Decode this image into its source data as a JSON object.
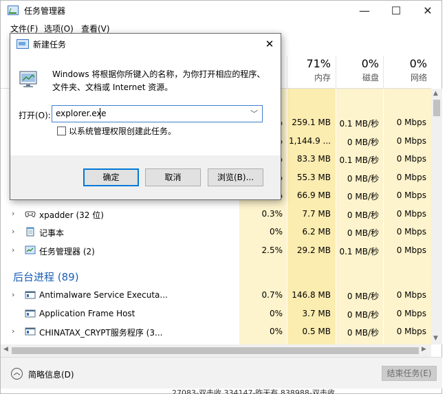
{
  "window": {
    "title": "任务管理器",
    "controls": {
      "minimize": "—",
      "maximize": "☐",
      "close": "✕"
    }
  },
  "menu": [
    "文件(F)",
    "选项(O)",
    "查看(V)"
  ],
  "columns": [
    {
      "pct": "71%",
      "name": "内存"
    },
    {
      "pct": "0%",
      "name": "磁盘"
    },
    {
      "pct": "0%",
      "name": "网络"
    }
  ],
  "rows": [
    {
      "name": "",
      "cpu": "%",
      "mem": "259.1 MB",
      "disk": "0.1 MB/秒",
      "net": "0 Mbps",
      "expand": false,
      "icon": ""
    },
    {
      "name": "",
      "cpu": "%",
      "mem": "1,144.9 ...",
      "disk": "0 MB/秒",
      "net": "0 Mbps",
      "expand": false,
      "icon": ""
    },
    {
      "name": "",
      "cpu": "%",
      "mem": "83.3 MB",
      "disk": "0.1 MB/秒",
      "net": "0 Mbps",
      "expand": false,
      "icon": ""
    },
    {
      "name": "",
      "cpu": "%",
      "mem": "55.3 MB",
      "disk": "0 MB/秒",
      "net": "0 Mbps",
      "expand": false,
      "icon": ""
    },
    {
      "name": "",
      "cpu": "%",
      "mem": "66.9 MB",
      "disk": "0 MB/秒",
      "net": "0 Mbps",
      "expand": false,
      "icon": ""
    },
    {
      "name": "xpadder (32 位)",
      "cpu": "0.3%",
      "mem": "7.7 MB",
      "disk": "0 MB/秒",
      "net": "0 Mbps",
      "expand": true,
      "icon": "gamepad-icon"
    },
    {
      "name": "记事本",
      "cpu": "0%",
      "mem": "6.2 MB",
      "disk": "0 MB/秒",
      "net": "0 Mbps",
      "expand": true,
      "icon": "notepad-icon"
    },
    {
      "name": "任务管理器 (2)",
      "cpu": "2.5%",
      "mem": "29.2 MB",
      "disk": "0.1 MB/秒",
      "net": "0 Mbps",
      "expand": true,
      "icon": "task-manager-icon"
    }
  ],
  "background_group": {
    "title": "后台进程 (89)"
  },
  "bg_rows": [
    {
      "name": "Antimalware Service Executa...",
      "cpu": "0.7%",
      "mem": "146.8 MB",
      "disk": "0 MB/秒",
      "net": "0 Mbps",
      "expand": true,
      "icon": "service-icon"
    },
    {
      "name": "Application Frame Host",
      "cpu": "0%",
      "mem": "3.7 MB",
      "disk": "0 MB/秒",
      "net": "0 Mbps",
      "expand": false,
      "icon": "app-icon"
    },
    {
      "name": "CHINATAX_CRYPT服务程序 (3...",
      "cpu": "0%",
      "mem": "0.5 MB",
      "disk": "0 MB/秒",
      "net": "0 Mbps",
      "expand": true,
      "icon": "service-icon"
    }
  ],
  "footer": {
    "fewer_details": "简略信息(D)",
    "end_task": "结束任务(E)",
    "bottom_strip": "27083-双击收      334147-昨天有      838988-双击收"
  },
  "run_dialog": {
    "title": "新建任务",
    "close": "✕",
    "description": "Windows 将根据你所键入的名称，为你打开相应的程序、文件夹、文档或 Internet 资源。",
    "open_label": "打开(O):",
    "open_value": "explorer.exe",
    "admin_checkbox": "以系统管理权限创建此任务。",
    "admin_checked": false,
    "buttons": {
      "ok": "确定",
      "cancel": "取消",
      "browse": "浏览(B)..."
    }
  },
  "colors": {
    "accent": "#1a5fb4",
    "cpu_band": "#fdf3cc",
    "mem_band": "#fbecb0",
    "primary_border": "#0078d7"
  }
}
